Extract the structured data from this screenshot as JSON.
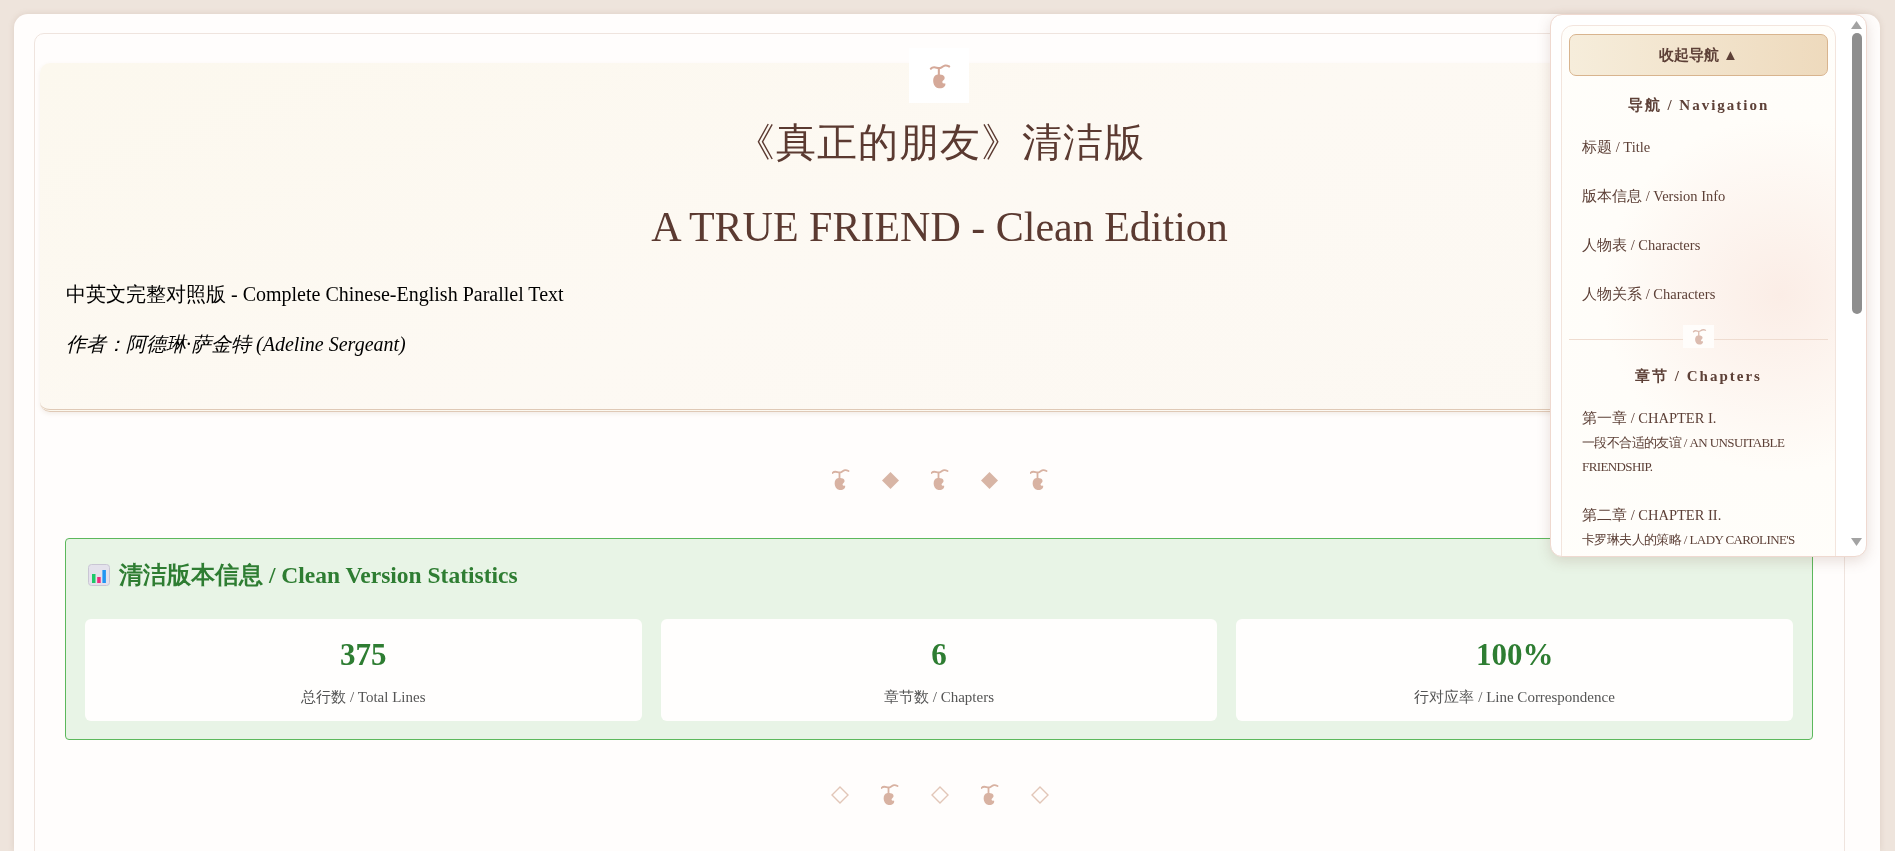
{
  "main": [
    {
      "kind": "header",
      "emblem": {
        "kind": "cherry"
      },
      "title_zh": "《真正的朋友》清洁版",
      "title_en": "A TRUE FRIEND - Clean Edition",
      "subtitle": "中英文完整对照版 - Complete Chinese-English Parallel Text",
      "author": "作者：阿德琳·萨金特 (Adeline Sergeant)"
    },
    {
      "kind": "divider",
      "ornaments": [
        {
          "kind": "cherry"
        },
        {
          "kind": "diamond"
        },
        {
          "kind": "cherry"
        },
        {
          "kind": "diamond"
        },
        {
          "kind": "cherry"
        }
      ]
    },
    {
      "kind": "stats",
      "title": "清洁版本信息 / Clean Version Statistics",
      "items": [
        {
          "value": "375",
          "label": "总行数 / Total Lines"
        },
        {
          "value": "6",
          "label": "章节数 / Chapters"
        },
        {
          "value": "100%",
          "label": "行对应率 / Line Correspondence"
        }
      ]
    },
    {
      "kind": "divider",
      "ornaments": [
        {
          "kind": "diamond_outline"
        },
        {
          "kind": "cherry"
        },
        {
          "kind": "diamond_outline"
        },
        {
          "kind": "cherry"
        },
        {
          "kind": "diamond_outline"
        }
      ]
    }
  ],
  "nav": {
    "toggle": "收起导航 ▲",
    "sections": [
      {
        "heading": "导航 / Navigation",
        "items": [
          {
            "label": "标题 / Title"
          },
          {
            "label": "版本信息 / Version Info"
          },
          {
            "label": "人物表 / Characters"
          },
          {
            "label": "人物关系 / Characters"
          }
        ]
      },
      {
        "heading": "章节 / Chapters",
        "items": [
          {
            "label": "第一章 / CHAPTER I.",
            "subtitle": "一段不合适的友谊 / AN UNSUITABLE FRIENDSHIP."
          },
          {
            "label": "第二章 / CHAPTER II.",
            "subtitle": "卡罗琳夫人的策略 / LADY CAROLINE'S"
          }
        ]
      }
    ]
  }
}
